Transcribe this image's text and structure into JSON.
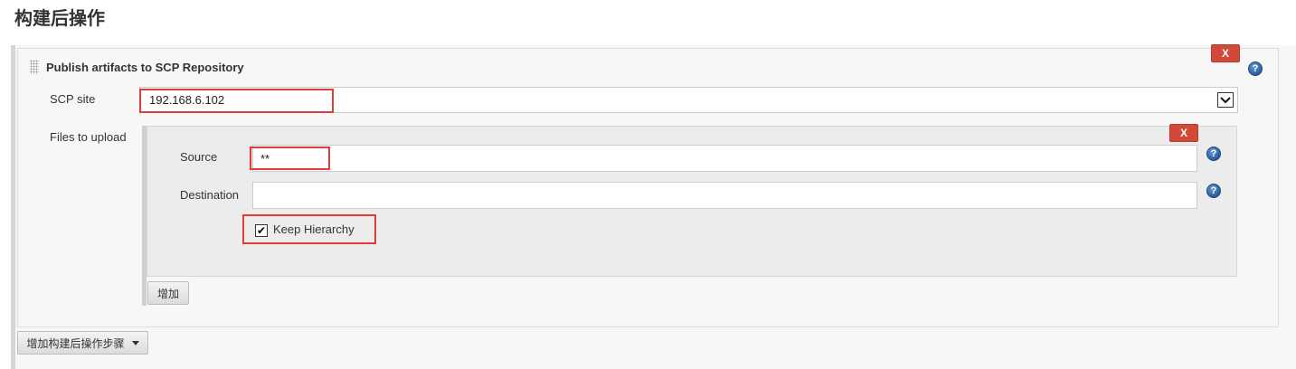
{
  "page": {
    "title": "构建后操作"
  },
  "publish_section": {
    "title": "Publish artifacts to SCP Repository",
    "delete_label": "X",
    "help_label": "?"
  },
  "scp_site": {
    "label": "SCP site",
    "value": "192.168.6.102"
  },
  "files_to_upload": {
    "label": "Files to upload",
    "delete_label": "X",
    "source": {
      "label": "Source",
      "value": "**",
      "help_label": "?"
    },
    "destination": {
      "label": "Destination",
      "value": "",
      "help_label": "?"
    },
    "keep_hierarchy": {
      "label": "Keep Hierarchy",
      "checked": true,
      "check_glyph": "✔"
    },
    "add_button": "增加"
  },
  "add_post_build_step": {
    "label": "增加构建后操作步骤"
  },
  "colors": {
    "delete_red": "#d24939",
    "highlight_red": "#e03c3c",
    "help_blue": "#2a5a9c"
  }
}
